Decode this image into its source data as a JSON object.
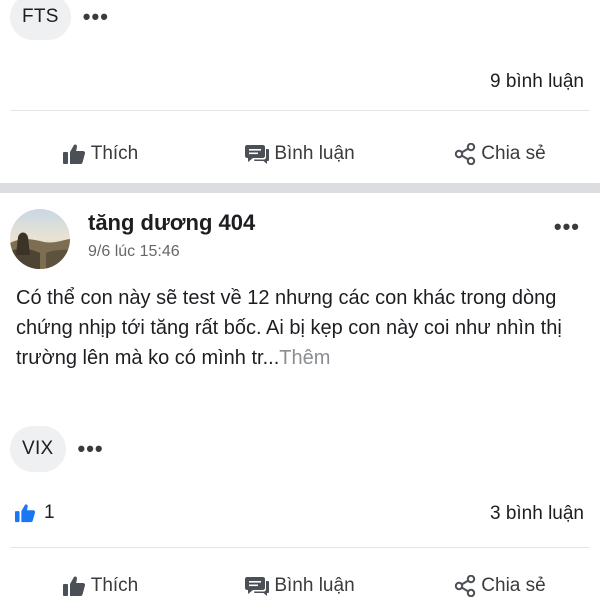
{
  "top_post": {
    "ticker": "FTS",
    "more_label": "•••",
    "comment_count": "9 bình luận"
  },
  "actions": {
    "like": "Thích",
    "comment": "Bình luận",
    "share": "Chia sẻ"
  },
  "post": {
    "author": "tăng dương 404",
    "timestamp": "9/6 lúc 15:46",
    "menu_label": "•••",
    "text": "Có thể con này sẽ test về 12 nhưng các con khác trong dòng chứng nhịp tới tăng rất bốc. Ai bị kẹp con này coi như nhìn thị trường lên mà ko có mình tr...",
    "see_more": "Thêm",
    "ticker": "VIX",
    "more_label": "•••",
    "like_count": "1",
    "comment_count": "3 bình luận"
  },
  "icons": {
    "like": "thumbs-up-icon",
    "comment": "speech-bubble-icon",
    "share": "share-icon",
    "reaction": "like-reaction-icon"
  },
  "colors": {
    "reaction_blue": "#1877f2",
    "chip_bg": "#eef0f2",
    "separator": "#dcdde0",
    "muted_text": "#65676b"
  }
}
